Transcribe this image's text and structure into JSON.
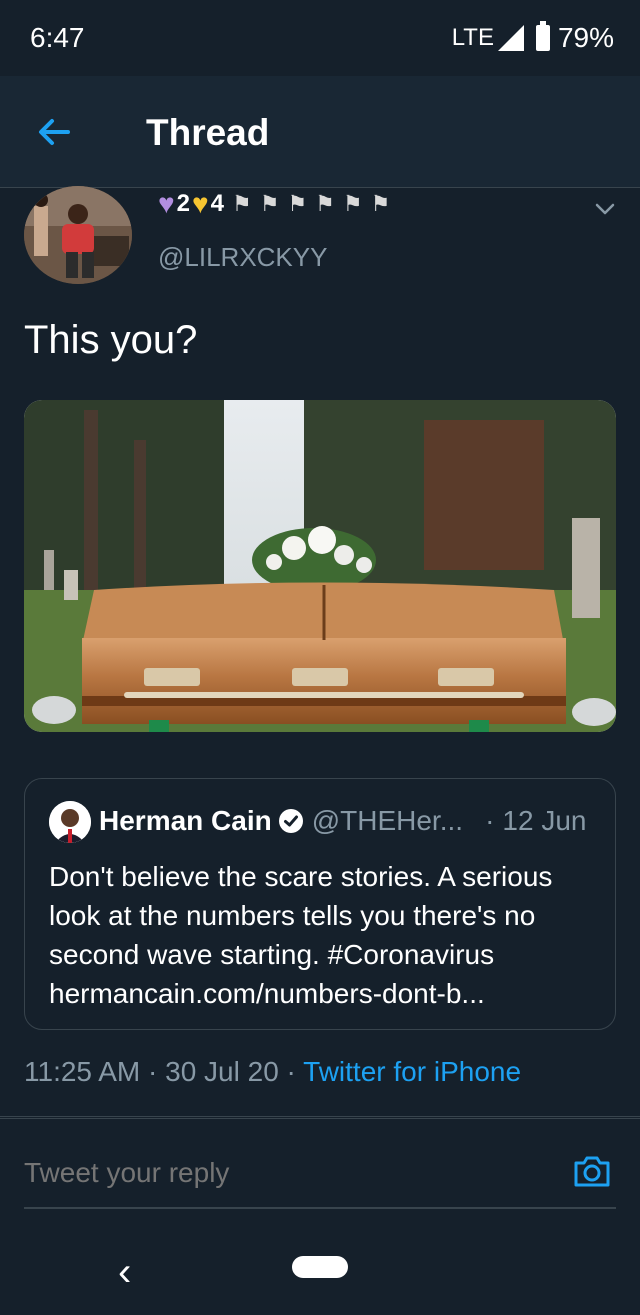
{
  "status_bar": {
    "time": "6:47",
    "network": "LTE",
    "battery": "79%"
  },
  "header": {
    "title": "Thread"
  },
  "tweet": {
    "display_name_count_1": "2",
    "display_name_count_2": "4",
    "handle": "@LILRXCKYY",
    "text": "This you?",
    "quote": {
      "name": "Herman Cain",
      "handle": "@THEHer...",
      "date": "12 Jun",
      "text": "Don't believe the scare stories. A serious look at the numbers tells you there's no second wave starting. #Coronavirus hermancain.com/numbers-dont-b..."
    },
    "meta": {
      "time": "11:25 AM",
      "date": "30 Jul 20",
      "source": "Twitter for iPhone"
    }
  },
  "reply": {
    "placeholder": "Tweet your reply"
  },
  "icons": [
    "back-arrow-icon",
    "chevron-down-icon",
    "verified-badge-icon",
    "camera-icon",
    "nav-back-icon"
  ],
  "colors": {
    "background": "#15202b",
    "accent": "#1da1f2",
    "secondary_text": "#8899a6",
    "border": "#38444d"
  }
}
